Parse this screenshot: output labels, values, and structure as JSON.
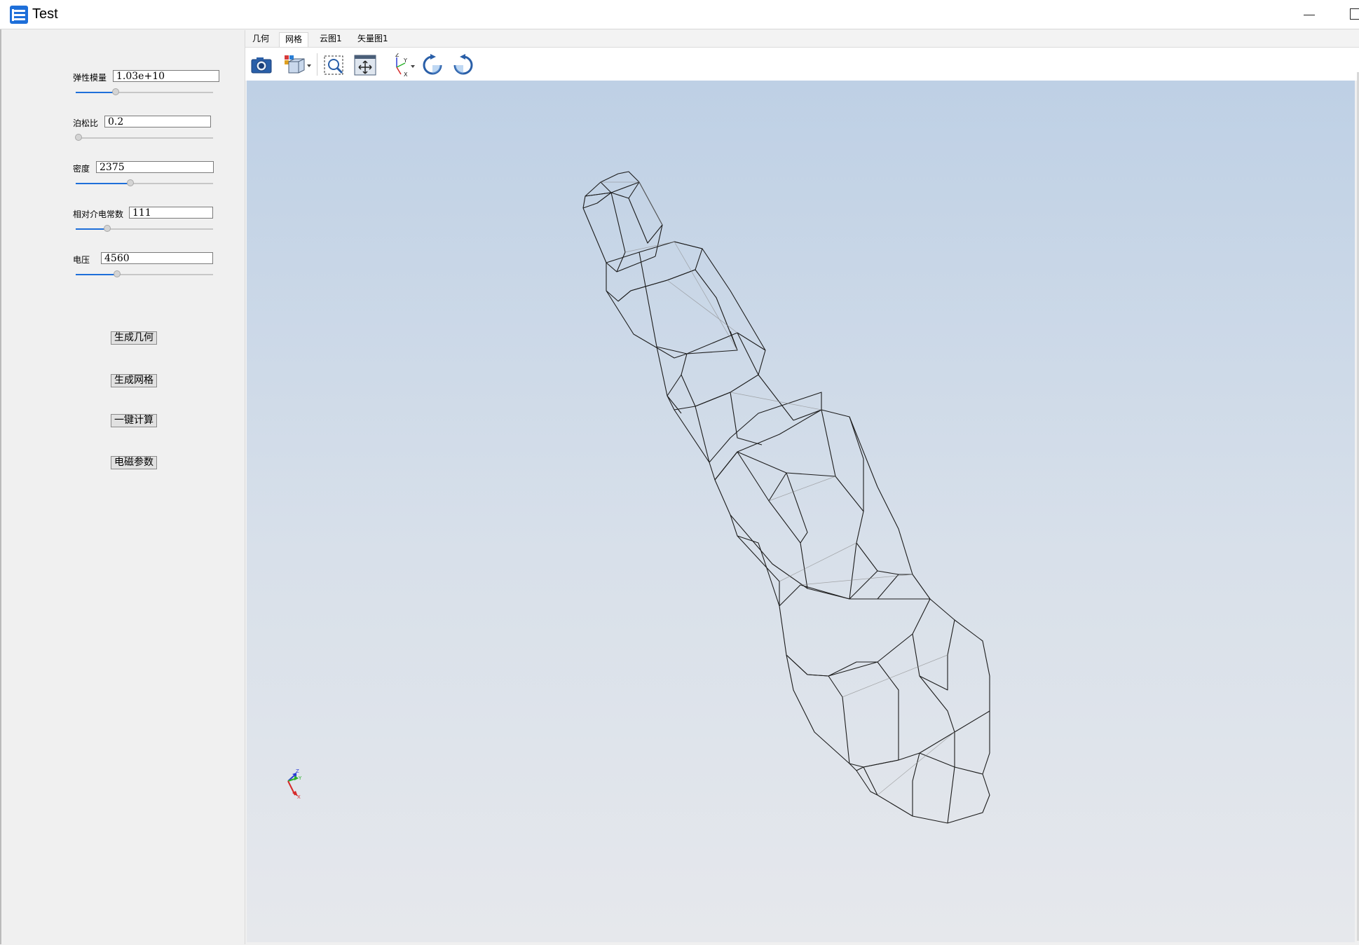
{
  "window": {
    "title": "Test",
    "minimize_icon": "minimize-icon",
    "maximize_icon": "maximize-icon",
    "accent": "#1e6fd9"
  },
  "params": [
    {
      "label": "弹性模量",
      "value": "1.03e+10",
      "slider": 0.27
    },
    {
      "label": "泊松比",
      "value": "0.2",
      "slider": 0.0
    },
    {
      "label": "密度",
      "value": "2375",
      "slider": 0.38
    },
    {
      "label": "相对介电常数",
      "value": "111",
      "slider": 0.21
    },
    {
      "label": "电压",
      "value": "4560",
      "slider": 0.28
    }
  ],
  "buttons": {
    "generate_geometry": "生成几何",
    "generate_mesh": "生成网格",
    "one_click_compute": "一键计算",
    "em_params": "电磁参数"
  },
  "tabs": [
    {
      "label": "几何",
      "active": false
    },
    {
      "label": "网格",
      "active": true
    },
    {
      "label": "云图1",
      "active": false
    },
    {
      "label": "矢量图1",
      "active": false
    }
  ],
  "toolbar": {
    "icons": [
      "camera-icon",
      "view-cube-icon",
      "zoom-box-icon",
      "fit-view-icon",
      "axes-orientation-icon",
      "rotate-cw-icon",
      "rotate-ccw-icon"
    ]
  },
  "axes_triad": {
    "labels": [
      "Z",
      "Y",
      "X"
    ],
    "colors": [
      "#2a3bd6",
      "#2bb32b",
      "#d62a2a"
    ]
  }
}
